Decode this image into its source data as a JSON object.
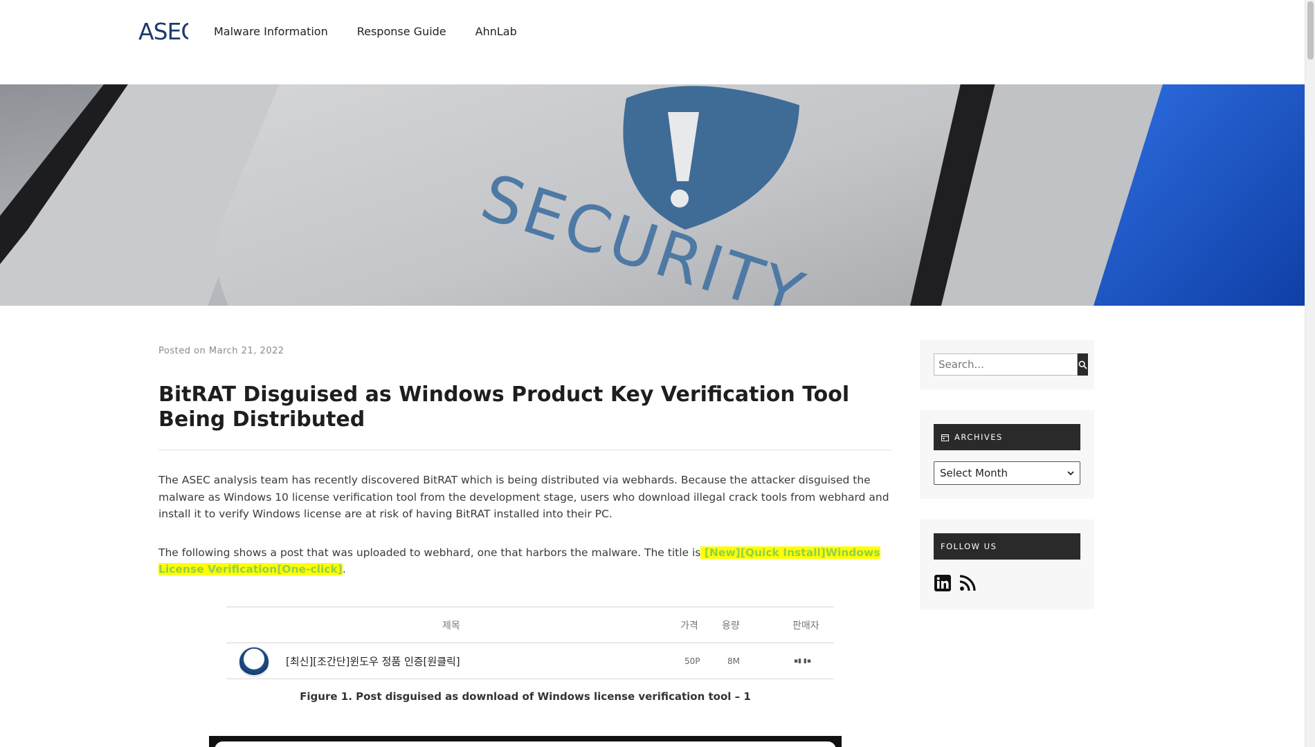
{
  "header": {
    "logo_text": "ASEC",
    "nav": [
      {
        "label": "Malware Information"
      },
      {
        "label": "Response Guide"
      },
      {
        "label": "AhnLab"
      }
    ]
  },
  "hero": {
    "key_text": "SECURITY",
    "icon": "shield-exclamation-icon",
    "colors": {
      "key": "#c4c6c9",
      "shield": "#3f6b97",
      "accent": "#1b56c9"
    }
  },
  "article": {
    "posted_prefix": "Posted on",
    "posted_date": "March 21, 2022",
    "title": "BitRAT Disguised as Windows Product Key Verification Tool Being Distributed",
    "para1": "The ASEC analysis team has recently discovered BitRAT which is being distributed via webhards. Because the attacker disguised the malware as Windows 10 license verification tool from the development stage, users who download illegal crack tools from webhard and install it to verify Windows license are at risk of having BitRAT installed into their PC.",
    "para2_prefix": "The following shows a post that was uploaded to webhard, one that harbors the malware. The title is",
    "para2_highlight": " [New][Quick Install]Windows License Verification[One-click]",
    "para2_suffix": ".",
    "highlight_color": "#ffff00",
    "figure1": {
      "columns": [
        "제목",
        "가격",
        "용량",
        "판매자"
      ],
      "row": {
        "title": "[최신][조간단]윈도우 정품 인증[원클릭]",
        "price": "50P",
        "size": "8M",
        "seller": "▪︎▮ ▮▪︎"
      },
      "caption": "Figure 1. Post disguised as download of Windows license verification tool – 1"
    }
  },
  "sidebar": {
    "search_placeholder": "Search...",
    "archives_title": "ARCHIVES",
    "archives_select": "Select Month",
    "follow_title": "FOLLOW US",
    "social_icons": [
      "linkedin-icon",
      "rss-icon"
    ]
  }
}
